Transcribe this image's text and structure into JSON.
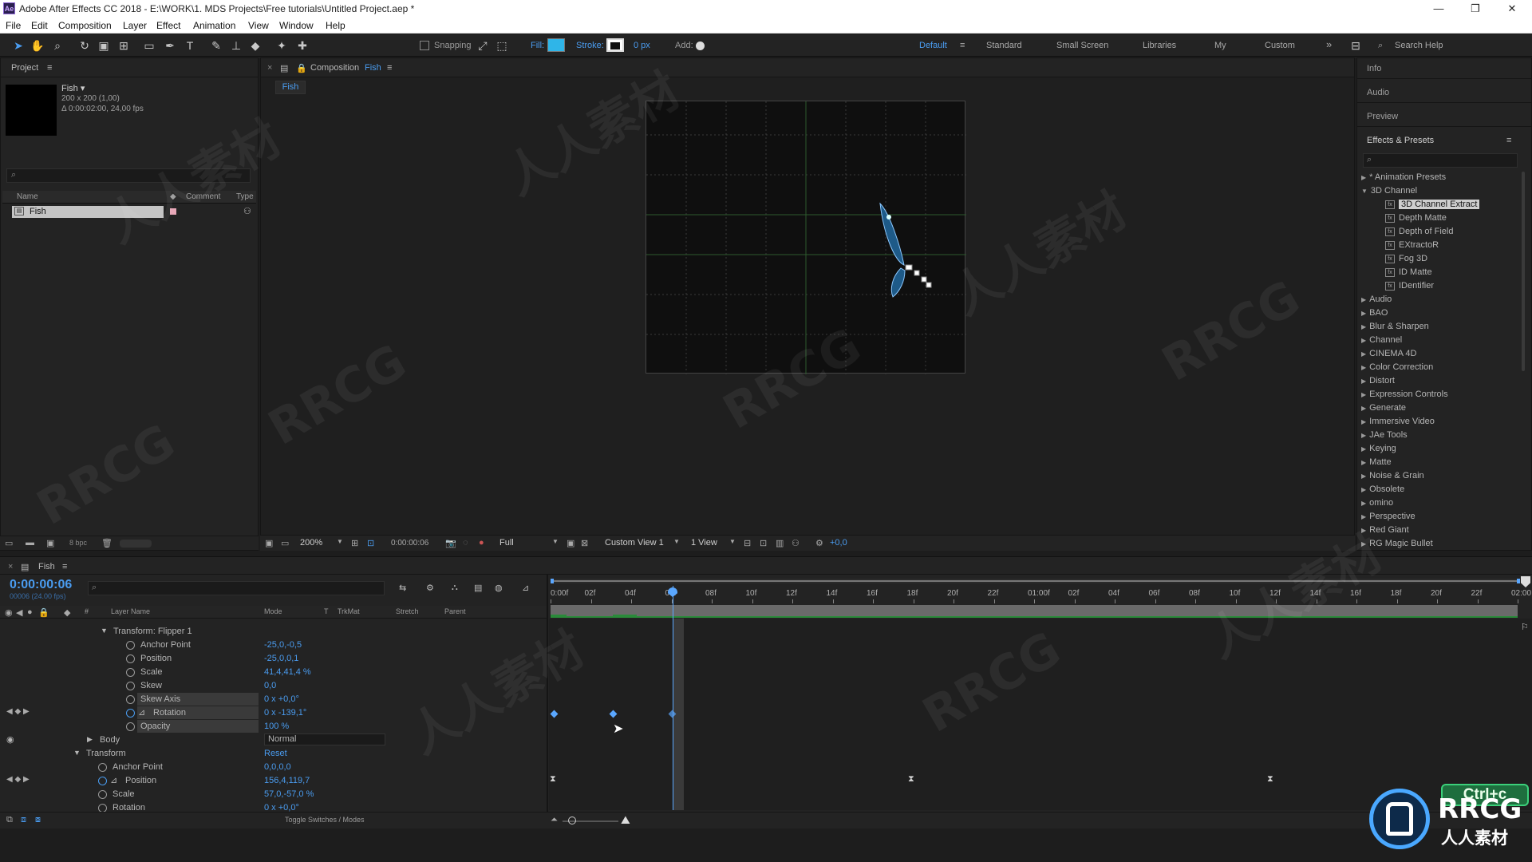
{
  "window": {
    "app_badge": "Ae",
    "title": "Adobe After Effects CC 2018 - E:\\WORK\\1. MDS Projects\\Free tutorials\\Untitled Project.aep *",
    "minimize": "—",
    "maximize": "❐",
    "close": "✕"
  },
  "menu": [
    "File",
    "Edit",
    "Composition",
    "Layer",
    "Effect",
    "Animation",
    "View",
    "Window",
    "Help"
  ],
  "toolbar": {
    "snapping": "Snapping",
    "fill": "Fill:",
    "stroke": "Stroke:",
    "stroke_px": "0 px",
    "add": "Add:",
    "fill_color": "#2fb5e8",
    "workspaces": [
      "Default",
      "Standard",
      "Small Screen",
      "Libraries",
      "My",
      "Custom"
    ],
    "active_workspace": "Default",
    "more": "»",
    "search_help": "Search Help"
  },
  "project": {
    "title": "Project",
    "comp_name": "Fish ▾",
    "comp_info1": "200 x 200 (1,00)",
    "comp_info2": "Δ 0:00:02:00, 24,00 fps",
    "columns": [
      "Name",
      "Comment",
      "Type"
    ],
    "items": [
      {
        "name": "Fish"
      }
    ],
    "bpc": "8 bpc"
  },
  "composition": {
    "tab_prefix": "Composition",
    "tab_name": "Fish",
    "sub_tab": "Fish",
    "zoom": "200%",
    "timecode": "0:00:00:06",
    "resolution": "Full",
    "view": "Custom View 1",
    "views": "1 View",
    "exposure": "+0,0"
  },
  "right_panel": {
    "tabs": [
      "Info",
      "Audio",
      "Preview"
    ],
    "effects_title": "Effects & Presets",
    "tree": [
      {
        "label": "* Animation Presets",
        "level": 0,
        "open": false
      },
      {
        "label": "3D Channel",
        "level": 0,
        "open": true
      },
      {
        "label": "3D Channel Extract",
        "level": 1,
        "selected": true
      },
      {
        "label": "Depth Matte",
        "level": 1
      },
      {
        "label": "Depth of Field",
        "level": 1
      },
      {
        "label": "EXtractoR",
        "level": 1
      },
      {
        "label": "Fog 3D",
        "level": 1
      },
      {
        "label": "ID Matte",
        "level": 1
      },
      {
        "label": "IDentifier",
        "level": 1
      },
      {
        "label": "Audio",
        "level": 0
      },
      {
        "label": "BAO",
        "level": 0
      },
      {
        "label": "Blur & Sharpen",
        "level": 0
      },
      {
        "label": "Channel",
        "level": 0
      },
      {
        "label": "CINEMA 4D",
        "level": 0
      },
      {
        "label": "Color Correction",
        "level": 0
      },
      {
        "label": "Distort",
        "level": 0
      },
      {
        "label": "Expression Controls",
        "level": 0
      },
      {
        "label": "Generate",
        "level": 0
      },
      {
        "label": "Immersive Video",
        "level": 0
      },
      {
        "label": "JAe Tools",
        "level": 0
      },
      {
        "label": "Keying",
        "level": 0
      },
      {
        "label": "Matte",
        "level": 0
      },
      {
        "label": "Noise & Grain",
        "level": 0
      },
      {
        "label": "Obsolete",
        "level": 0
      },
      {
        "label": "omino",
        "level": 0
      },
      {
        "label": "Perspective",
        "level": 0
      },
      {
        "label": "Red Giant",
        "level": 0
      },
      {
        "label": "RG Magic Bullet",
        "level": 0
      }
    ]
  },
  "timeline": {
    "tab": "Fish",
    "timecode": "0:00:00:06",
    "sub_timecode": "00006 (24.00 fps)",
    "columns": [
      "Layer Name",
      "Mode",
      "T",
      "TrkMat",
      "Stretch",
      "Parent"
    ],
    "ruler": [
      "0:00f",
      "02f",
      "04f",
      "06f",
      "08f",
      "10f",
      "12f",
      "14f",
      "16f",
      "18f",
      "20f",
      "22f",
      "01:00f",
      "02f",
      "04f",
      "06f",
      "08f",
      "10f",
      "12f",
      "14f",
      "16f",
      "18f",
      "20f",
      "22f",
      "02:00"
    ],
    "rows": [
      {
        "label": "Transform: Flipper 1",
        "value": "",
        "kind": "group"
      },
      {
        "label": "Anchor Point",
        "value": "-25,0,-0,5"
      },
      {
        "label": "Position",
        "value": "-25,0,0,1"
      },
      {
        "label": "Scale",
        "value": "41,4,41,4 %"
      },
      {
        "label": "Skew",
        "value": "0,0"
      },
      {
        "label": "Skew Axis",
        "value": "0 x +0,0°"
      },
      {
        "label": "Rotation",
        "value": "0 x -139,1°"
      },
      {
        "label": "Opacity",
        "value": "100 %"
      },
      {
        "label": "Body",
        "value": "Normal",
        "kind": "layer"
      },
      {
        "label": "Transform",
        "value": "Reset",
        "kind": "transform"
      },
      {
        "label": "Anchor Point",
        "value": "0,0,0,0"
      },
      {
        "label": "Position",
        "value": "156,4,119,7"
      },
      {
        "label": "Scale",
        "value": "57,0,-57,0 %"
      },
      {
        "label": "Rotation",
        "value": "0 x +0,0°"
      }
    ],
    "toggle": "Toggle Switches / Modes",
    "playhead_frame": 6
  },
  "watermark": {
    "text": "RRCG",
    "sub": "人人素材",
    "badge": "Ctrl+c",
    "logo_text": "RRCG",
    "logo_sub": "人人素材"
  }
}
